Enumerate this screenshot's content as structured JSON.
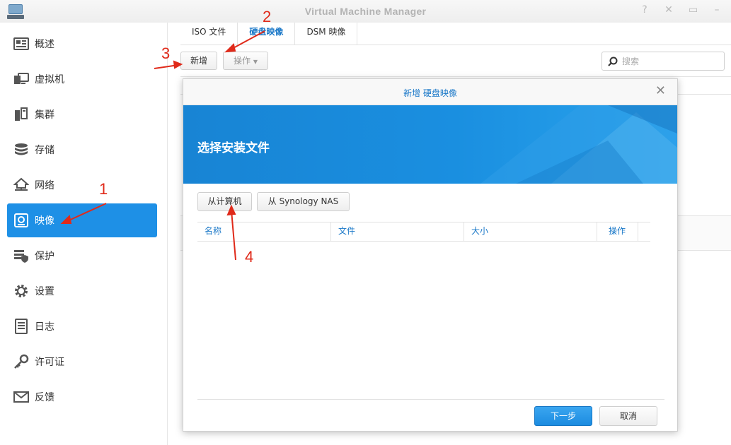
{
  "window": {
    "title": "Virtual Machine Manager"
  },
  "sidebar": {
    "items": [
      {
        "label": "概述",
        "icon": "overview-icon"
      },
      {
        "label": "虚拟机",
        "icon": "vm-icon"
      },
      {
        "label": "集群",
        "icon": "cluster-icon"
      },
      {
        "label": "存储",
        "icon": "storage-icon"
      },
      {
        "label": "网络",
        "icon": "network-icon"
      },
      {
        "label": "映像",
        "icon": "image-icon",
        "active": true
      },
      {
        "label": "保护",
        "icon": "protection-icon"
      },
      {
        "label": "设置",
        "icon": "gear-icon"
      },
      {
        "label": "日志",
        "icon": "log-icon"
      },
      {
        "label": "许可证",
        "icon": "key-icon"
      },
      {
        "label": "反馈",
        "icon": "mail-icon"
      }
    ]
  },
  "tabs": [
    {
      "label": "ISO 文件"
    },
    {
      "label": "硬盘映像",
      "active": true
    },
    {
      "label": "DSM 映像"
    }
  ],
  "toolbar": {
    "create_label": "新增",
    "action_label": "操作",
    "search_placeholder": "搜索"
  },
  "dialog": {
    "title": "新增 硬盘映像",
    "heading": "选择安装文件",
    "from_computer_label": "从计算机",
    "from_nas_label": "从 Synology NAS",
    "columns": [
      "名称",
      "文件",
      "大小",
      "操作"
    ],
    "next_label": "下一步",
    "cancel_label": "取消"
  },
  "annotations": [
    "1",
    "2",
    "3",
    "4"
  ],
  "colors": {
    "accent": "#1e90e6",
    "annotation": "#e02a1a"
  }
}
